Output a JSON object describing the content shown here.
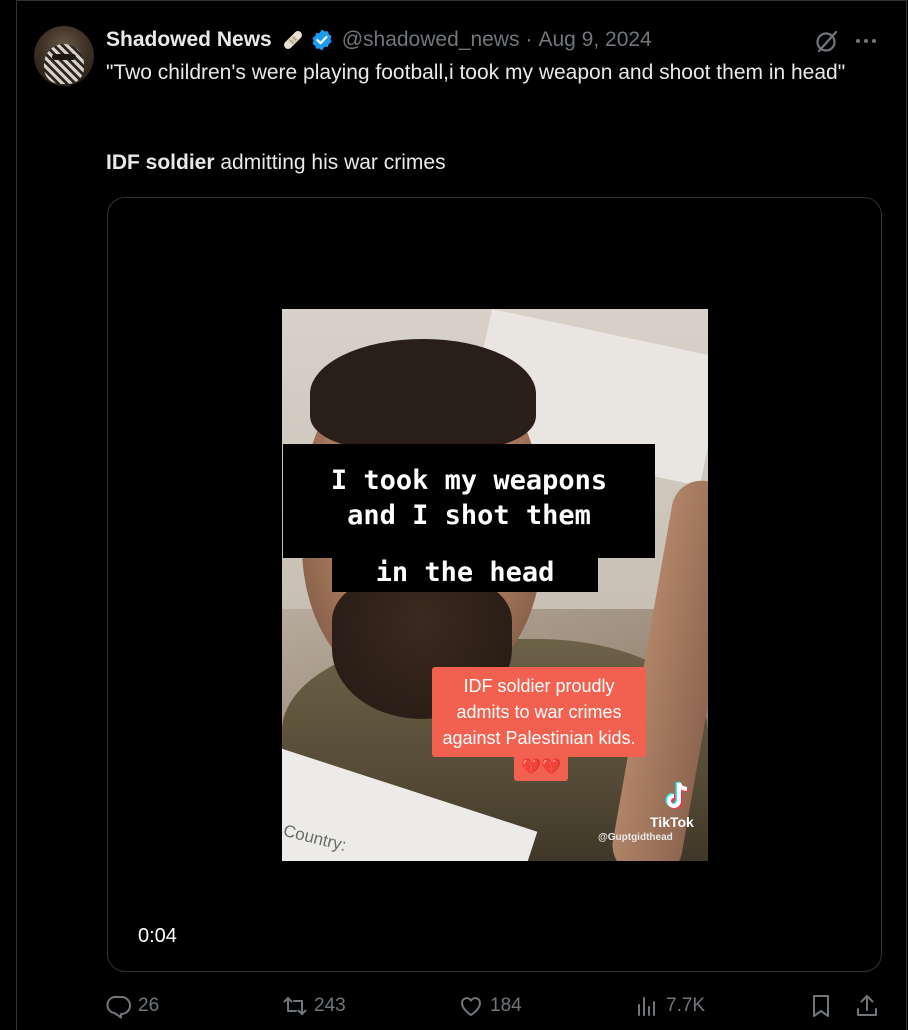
{
  "tweet": {
    "display_name": "Shadowed News",
    "handle": "@shadowed_news",
    "separator": "·",
    "date": "Aug 9, 2024",
    "text_line1": "\"Two children's were playing football,i took my weapon and shoot them in head\"",
    "text_bold": "IDF soldier",
    "text_rest": " admitting his war crimes"
  },
  "video": {
    "caption_line1": "I took my weapons",
    "caption_line2": "and I shot them",
    "caption_line3": "in the head",
    "red_line1": "IDF soldier proudly",
    "red_line2": "admits to war crimes",
    "red_line3": "against Palestinian kids.",
    "hearts": "💔💔",
    "country_text": "Country:",
    "tiktok_brand": "TikTok",
    "tiktok_user": "@Guptgidthead",
    "timestamp": "0:04"
  },
  "actions": {
    "replies": "26",
    "reposts": "243",
    "likes": "184",
    "views": "7.7K"
  },
  "colors": {
    "background": "#000000",
    "text": "#e7e9ea",
    "muted": "#71767b",
    "verified": "#1d9bf0",
    "red_box": "#f2614f"
  },
  "icons": [
    "bandage-icon",
    "verified-icon",
    "grok-icon",
    "more-icon",
    "reply-icon",
    "retweet-icon",
    "like-icon",
    "views-icon",
    "bookmark-icon",
    "share-icon",
    "tiktok-icon"
  ]
}
